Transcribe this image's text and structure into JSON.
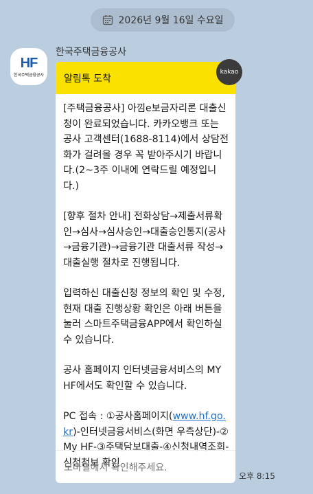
{
  "date": {
    "label": "2026년 9월 16일 수요일",
    "icon": "calendar-icon"
  },
  "sender": {
    "name": "한국주택금융공사",
    "avatar_logo": "HF",
    "avatar_text": "한국주택금융공사",
    "brand_color": "#1c5aa8"
  },
  "message": {
    "header": "알림톡 도착",
    "header_color": "#fae100",
    "paragraphs": [
      "[주택금융공사] 아낌e보금자리론 대출신청이 완료되었습니다. 카카오뱅크 또는 공사 고객센터(1688-8114)에서 상담전화가 걸려올 경우 꼭 받아주시기 바랍니다.(2~3주 이내에 연락드릴 예정입니다.)",
      "[향후 절차 안내] 전화상담→제출서류확인→심사→심사승인→대출승인통지(공사→금융기관)→금융기관 대출서류 작성→대출실행 절차로 진행됩니다.",
      "입력하신 대출신청 정보의 확인 및 수정, 현재 대출 진행상황 확인은 아래 버튼을 눌러 스마트주택금융APP에서 확인하실 수 있습니다.",
      "공사 홈페이지 인터넷금융서비스의 MY HF에서도 확인할 수 있습니다."
    ],
    "pc_prefix": "PC 접속 : ①공사홈페이지(",
    "pc_link": "www.hf.go.kr",
    "pc_suffix": ")-인터넷금융서비스(화면 우측상단)-②My HF-③주택담보대출-④신청내역조회-신청청보 확인",
    "footer": "모바일에서 확인해주세요."
  },
  "badge": "kakao",
  "time": "오후 8:15"
}
